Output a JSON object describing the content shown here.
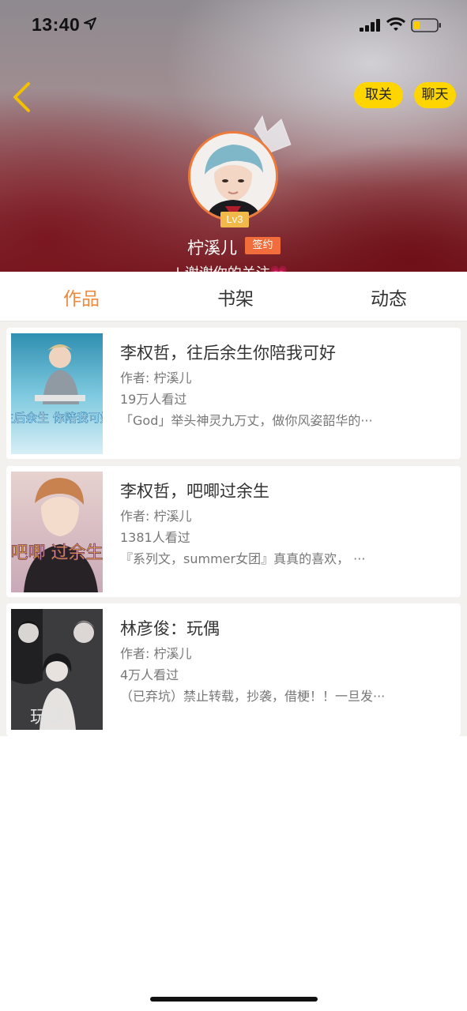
{
  "status_bar": {
    "time": "13:40"
  },
  "header": {
    "follow_label": "取关",
    "chat_label": "聊天",
    "username": "柠溪儿",
    "level": "Lv3",
    "signed_badge": "签约",
    "bio": "| 谢谢你的关注💗"
  },
  "tabs": [
    {
      "label": "作品",
      "active": true
    },
    {
      "label": "书架",
      "active": false
    },
    {
      "label": "动态",
      "active": false
    }
  ],
  "books": [
    {
      "title": "李权哲，往后余生你陪我可好",
      "author": "作者: 柠溪儿",
      "views": "19万人看过",
      "desc": "「God」举头神灵九万丈，做你风姿韶华的···",
      "cover_text": "往后余生 你陪我可好"
    },
    {
      "title": "李权哲，吧唧过余生",
      "author": "作者: 柠溪儿",
      "views": "1381人看过",
      "desc": "『系列文，summer女团』真真的喜欢，  ···",
      "cover_text": "吧唧 过余生"
    },
    {
      "title": "林彦俊：玩偶",
      "author": "作者: 柠溪儿",
      "views": "4万人看过",
      "desc": "（已弃坑）禁止转载，抄袭，借梗！！一旦发···",
      "cover_text": "玩偶"
    }
  ],
  "colors": {
    "accent": "#f08a3e",
    "button_yellow": "#ffd500",
    "badge_orange": "#f16e3c",
    "level_gold": "#f0b94a"
  }
}
